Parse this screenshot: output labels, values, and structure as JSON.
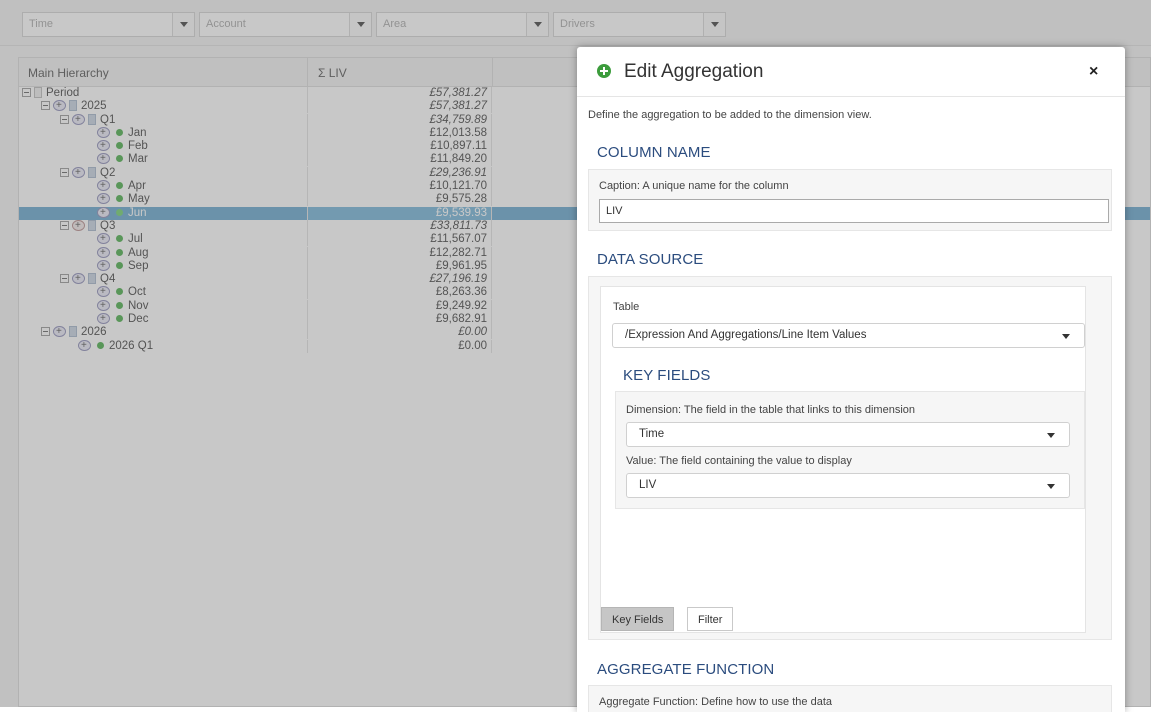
{
  "filters": [
    {
      "placeholder": "Time"
    },
    {
      "placeholder": "Account"
    },
    {
      "placeholder": "Area"
    },
    {
      "placeholder": "Drivers"
    }
  ],
  "grid": {
    "col_hierarchy": "Main Hierarchy",
    "col_value": "Σ LIV",
    "rows": [
      {
        "label": "Period",
        "value": "£57,381.27"
      },
      {
        "label": "2025",
        "value": "£57,381.27"
      },
      {
        "label": "Q1",
        "value": "£34,759.89"
      },
      {
        "label": "Jan",
        "value": "£12,013.58"
      },
      {
        "label": "Feb",
        "value": "£10,897.11"
      },
      {
        "label": "Mar",
        "value": "£11,849.20"
      },
      {
        "label": "Q2",
        "value": "£29,236.91"
      },
      {
        "label": "Apr",
        "value": "£10,121.70"
      },
      {
        "label": "May",
        "value": "£9,575.28"
      },
      {
        "label": "Jun",
        "value": "£9,539.93"
      },
      {
        "label": "Q3",
        "value": "£33,811.73"
      },
      {
        "label": "Jul",
        "value": "£11,567.07"
      },
      {
        "label": "Aug",
        "value": "£12,282.71"
      },
      {
        "label": "Sep",
        "value": "£9,961.95"
      },
      {
        "label": "Q4",
        "value": "£27,196.19"
      },
      {
        "label": "Oct",
        "value": "£8,263.36"
      },
      {
        "label": "Nov",
        "value": "£9,249.92"
      },
      {
        "label": "Dec",
        "value": "£9,682.91"
      },
      {
        "label": "2026",
        "value": "£0.00"
      },
      {
        "label": "2026 Q1",
        "value": "£0.00"
      }
    ]
  },
  "modal": {
    "title": "Edit Aggregation",
    "close": "×",
    "description": "Define the aggregation to be added to the dimension view.",
    "column_name": {
      "heading": "COLUMN NAME",
      "caption_label": "Caption: A unique name for the column",
      "caption_value": "LIV"
    },
    "data_source": {
      "heading": "DATA SOURCE",
      "table_label": "Table",
      "table_value": "/Expression And Aggregations/Line Item Values",
      "key_fields": {
        "heading": "KEY FIELDS",
        "dimension_label": "Dimension: The field in the table that links to this dimension",
        "dimension_value": "Time",
        "value_label": "Value: The field containing the value to display",
        "value_value": "LIV"
      },
      "tabs": [
        "Key Fields",
        "Filter"
      ]
    },
    "aggregate_function": {
      "heading": "AGGREGATE FUNCTION",
      "label": "Aggregate Function: Define how to use the data"
    }
  }
}
